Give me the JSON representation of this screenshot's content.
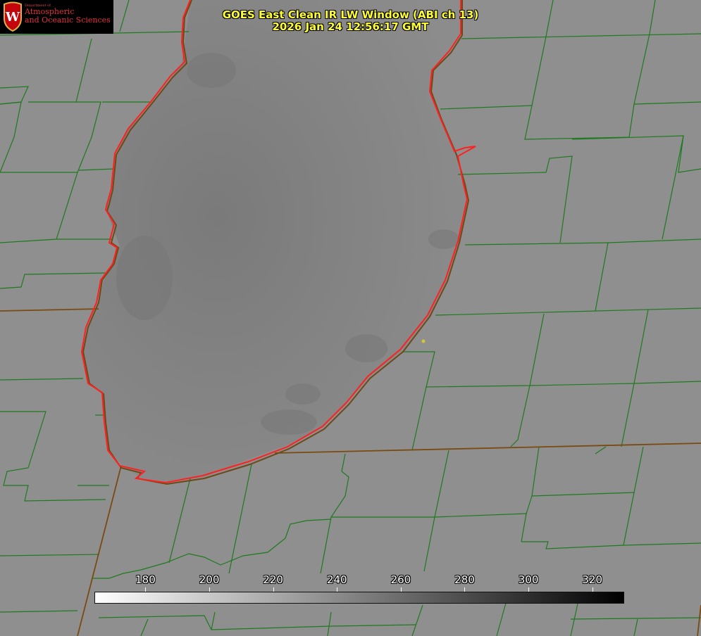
{
  "map": {
    "title_line1": "GOES East Clean IR LW Window (ABI ch 13)",
    "title_line2": "2026 Jan 24 12:56:17 GMT",
    "logo": {
      "dept": "Department of",
      "line1": "Atmospheric",
      "line2": "and Oceanic Sciences",
      "shield_letter": "W"
    },
    "colorbar": {
      "ticks": [
        "180",
        "200",
        "220",
        "240",
        "260",
        "280",
        "300",
        "320"
      ],
      "min": 164,
      "max": 330
    },
    "colors": {
      "county_lines": "#1e7a1e",
      "state_lines": "#7a4a10",
      "lake_shore": "#ff2020",
      "marker": "#d4c830"
    }
  }
}
